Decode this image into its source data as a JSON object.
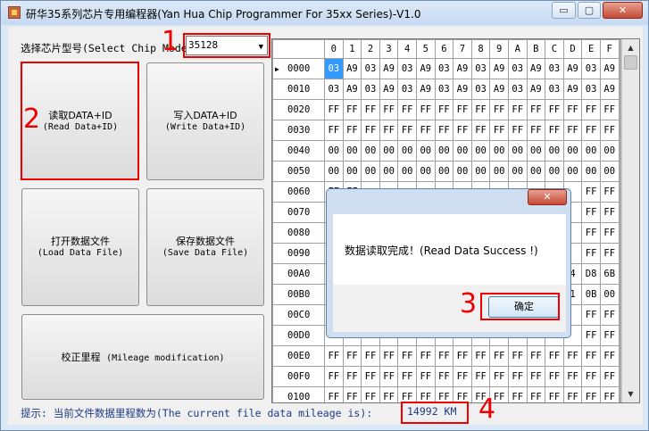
{
  "window": {
    "title": "研华35系列芯片专用编程器(Yan Hua Chip Programmer For 35xx Series)-V1.0",
    "min_glyph": "▭",
    "max_glyph": "▢",
    "close_glyph": "✕"
  },
  "chip": {
    "label": "选择芯片型号(Select Chip Model)",
    "value": "35128",
    "arrow": "▼"
  },
  "buttons": {
    "read": {
      "cn": "读取DATA+ID",
      "en": "(Read Data+ID)"
    },
    "write": {
      "cn": "写入DATA+ID",
      "en": "(Write Data+ID)"
    },
    "load": {
      "cn": "打开数据文件",
      "en": "(Load Data File)"
    },
    "save": {
      "cn": "保存数据文件",
      "en": "(Save Data File)"
    },
    "mileage": {
      "cn": "校正里程",
      "en": "(Mileage modification)"
    }
  },
  "annotations": {
    "n1": "1",
    "n2": "2",
    "n3": "3",
    "n4": "4"
  },
  "grid": {
    "columns": [
      "0",
      "1",
      "2",
      "3",
      "4",
      "5",
      "6",
      "7",
      "8",
      "9",
      "A",
      "B",
      "C",
      "D",
      "E",
      "F"
    ],
    "selected_row_marker": "▶",
    "rows": [
      {
        "addr": "0000",
        "cells": [
          "03",
          "A9",
          "03",
          "A9",
          "03",
          "A9",
          "03",
          "A9",
          "03",
          "A9",
          "03",
          "A9",
          "03",
          "A9",
          "03",
          "A9"
        ]
      },
      {
        "addr": "0010",
        "cells": [
          "03",
          "A9",
          "03",
          "A9",
          "03",
          "A9",
          "03",
          "A9",
          "03",
          "A9",
          "03",
          "A9",
          "03",
          "A9",
          "03",
          "A9"
        ]
      },
      {
        "addr": "0020",
        "cells": [
          "FF",
          "FF",
          "FF",
          "FF",
          "FF",
          "FF",
          "FF",
          "FF",
          "FF",
          "FF",
          "FF",
          "FF",
          "FF",
          "FF",
          "FF",
          "FF"
        ]
      },
      {
        "addr": "0030",
        "cells": [
          "FF",
          "FF",
          "FF",
          "FF",
          "FF",
          "FF",
          "FF",
          "FF",
          "FF",
          "FF",
          "FF",
          "FF",
          "FF",
          "FF",
          "FF",
          "FF"
        ]
      },
      {
        "addr": "0040",
        "cells": [
          "00",
          "00",
          "00",
          "00",
          "00",
          "00",
          "00",
          "00",
          "00",
          "00",
          "00",
          "00",
          "00",
          "00",
          "00",
          "00"
        ]
      },
      {
        "addr": "0050",
        "cells": [
          "00",
          "00",
          "00",
          "00",
          "00",
          "00",
          "00",
          "00",
          "00",
          "00",
          "00",
          "00",
          "00",
          "00",
          "00",
          "00"
        ]
      },
      {
        "addr": "0060",
        "cells": [
          "FF",
          "FF",
          "",
          "",
          "",
          "",
          "",
          "",
          "",
          "",
          "",
          "",
          "",
          "",
          "FF",
          "FF"
        ]
      },
      {
        "addr": "0070",
        "cells": [
          "",
          "",
          "",
          "",
          "",
          "",
          "",
          "",
          "",
          "",
          "",
          "",
          "",
          "",
          "FF",
          "FF"
        ]
      },
      {
        "addr": "0080",
        "cells": [
          "",
          "",
          "",
          "",
          "",
          "",
          "",
          "",
          "",
          "",
          "",
          "",
          "",
          "",
          "FF",
          "FF"
        ]
      },
      {
        "addr": "0090",
        "cells": [
          "",
          "",
          "",
          "",
          "",
          "",
          "",
          "",
          "",
          "",
          "",
          "",
          "",
          "",
          "FF",
          "FF"
        ]
      },
      {
        "addr": "00A0",
        "cells": [
          "",
          "",
          "",
          "",
          "",
          "",
          "",
          "",
          "",
          "",
          "",
          "",
          "",
          "4",
          "D8",
          "6B"
        ]
      },
      {
        "addr": "00B0",
        "cells": [
          "",
          "",
          "",
          "",
          "",
          "",
          "",
          "",
          "",
          "",
          "",
          "",
          "",
          "1",
          "0B",
          "00"
        ]
      },
      {
        "addr": "00C0",
        "cells": [
          "",
          "",
          "",
          "",
          "",
          "",
          "",
          "",
          "",
          "",
          "",
          "",
          "",
          "",
          "FF",
          "FF"
        ]
      },
      {
        "addr": "00D0",
        "cells": [
          "",
          "",
          "",
          "",
          "",
          "",
          "",
          "",
          "",
          "",
          "",
          "",
          "",
          "",
          "FF",
          "FF"
        ]
      },
      {
        "addr": "00E0",
        "cells": [
          "FF",
          "FF",
          "FF",
          "FF",
          "FF",
          "FF",
          "FF",
          "FF",
          "FF",
          "FF",
          "FF",
          "FF",
          "FF",
          "FF",
          "FF",
          "FF"
        ]
      },
      {
        "addr": "00F0",
        "cells": [
          "FF",
          "FF",
          "FF",
          "FF",
          "FF",
          "FF",
          "FF",
          "FF",
          "FF",
          "FF",
          "FF",
          "FF",
          "FF",
          "FF",
          "FF",
          "FF"
        ]
      },
      {
        "addr": "0100",
        "cells": [
          "FF",
          "FF",
          "FF",
          "FF",
          "FF",
          "FF",
          "FF",
          "FF",
          "FF",
          "FF",
          "FF",
          "FF",
          "FF",
          "FF",
          "FF",
          "FF"
        ]
      }
    ]
  },
  "scroll": {
    "up": "▲",
    "down": "▼"
  },
  "status": {
    "prefix": "提示: 当前文件数据里程数为(The current file data mileage is):",
    "value": "14992 KM"
  },
  "dialog": {
    "close": "✕",
    "message": "数据读取完成！(Read Data Success !)",
    "ok": "确定"
  },
  "colors": {
    "accent_red": "#e00000",
    "selection_blue": "#3399ff",
    "status_text": "#1c3b86"
  }
}
